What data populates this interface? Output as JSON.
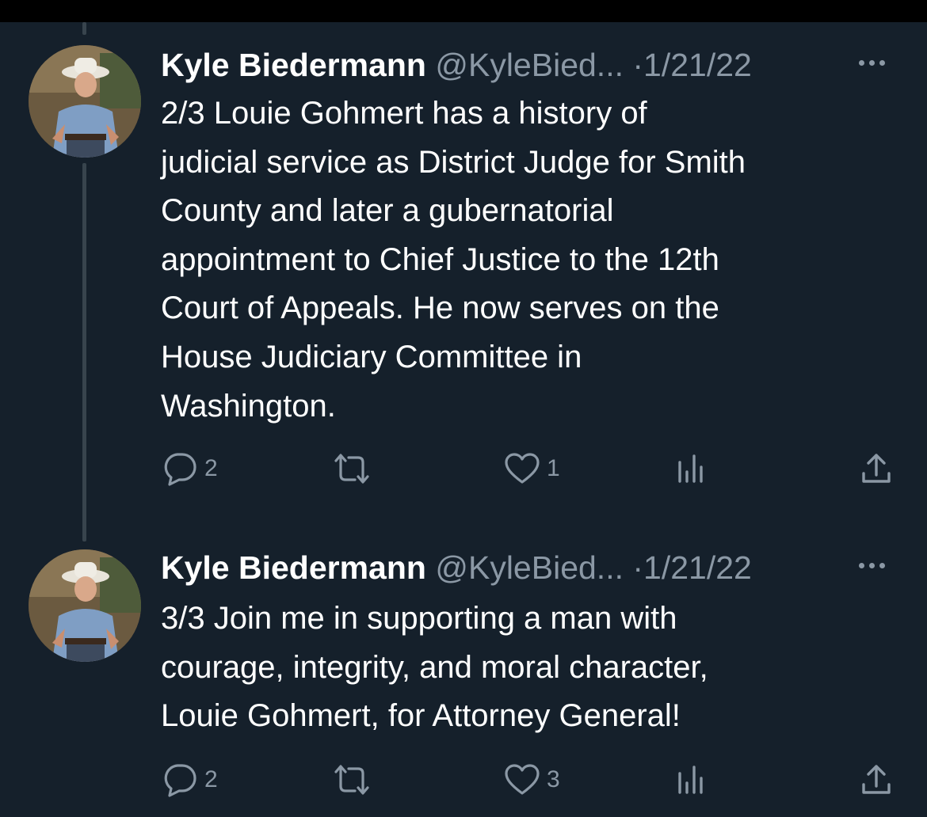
{
  "tweets": [
    {
      "name": "Kyle Biedermann",
      "handle": "@KyleBied...",
      "separator": "·",
      "date": "1/21/22",
      "text_lines": [
        "2/3 Louie Gohmert has a history of",
        "judicial service as District Judge for Smith",
        "County and later a gubernatorial",
        "appointment to Chief Justice to the 12th",
        "Court of Appeals. He now serves on the",
        "House Judiciary Committee in",
        "Washington."
      ],
      "replies": "2",
      "retweets": "",
      "likes": "1",
      "icons": [
        "reply-icon",
        "retweet-icon",
        "like-icon",
        "views-icon",
        "share-icon"
      ]
    },
    {
      "name": "Kyle Biedermann",
      "handle": "@KyleBied...",
      "separator": "·",
      "date": "1/21/22",
      "text_lines": [
        "3/3 Join me in supporting a man with",
        "courage, integrity, and moral character,",
        "Louie Gohmert, for Attorney General!"
      ],
      "replies": "2",
      "retweets": "",
      "likes": "3",
      "icons": [
        "reply-icon",
        "retweet-icon",
        "like-icon",
        "views-icon",
        "share-icon"
      ]
    }
  ],
  "colors": {
    "background": "#15202b",
    "text_primary": "#ffffff",
    "text_secondary": "#8b98a5",
    "thread_line": "#38444d"
  }
}
